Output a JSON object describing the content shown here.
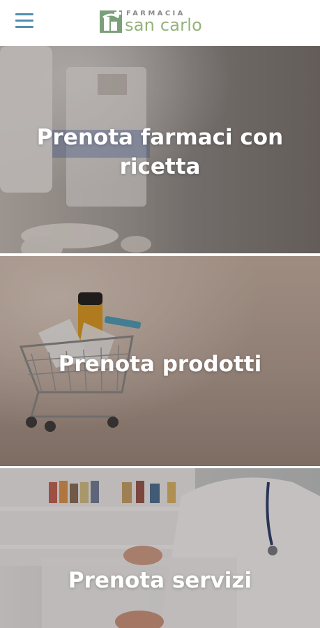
{
  "header": {
    "menu_icon": "hamburger-menu-icon",
    "logo": {
      "top_text": "FARMACIA",
      "main_text": "san carlo",
      "brand_color": "#95b27a",
      "accent_color": "#4f8fae"
    }
  },
  "tiles": [
    {
      "title": "Prenota farmaci con ricetta"
    },
    {
      "title": "Prenota prodotti"
    },
    {
      "title": "Prenota servizi"
    }
  ]
}
